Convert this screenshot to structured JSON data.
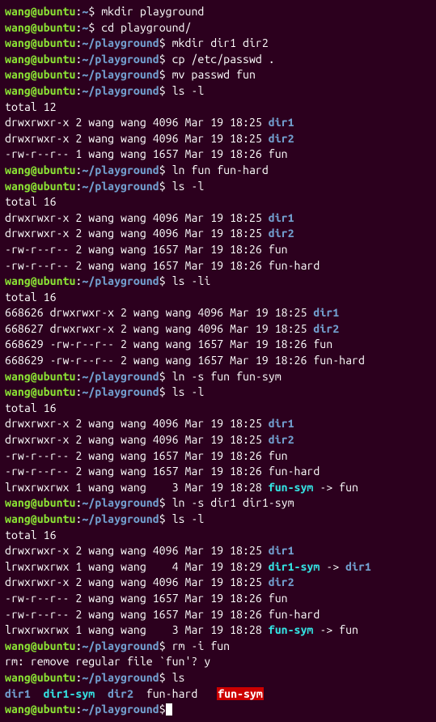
{
  "prompt": {
    "user": "wang",
    "at": "@",
    "host": "ubuntu",
    "colon": ":",
    "home": "~",
    "play": "~/playground",
    "dollar": "$"
  },
  "cmds": {
    "c1": " mkdir playground",
    "c2": " cd playground/",
    "c3": " mkdir dir1 dir2",
    "c4": " cp /etc/passwd .",
    "c5": " mv passwd fun",
    "c6": " ls -l",
    "c7": " ln fun fun-hard",
    "c8": " ls -l",
    "c9": " ls -li",
    "c10": " ln -s fun fun-sym",
    "c11": " ls -l",
    "c12": " ln -s dir1 dir1-sym",
    "c13": " ls -l",
    "c14": " rm -i fun",
    "c15": " ls",
    "c16": ""
  },
  "out": {
    "t12": "total 12",
    "t16": "total 16",
    "a1": "drwxrwxr-x 2 wang wang 4096 Mar 19 18:25 ",
    "a2": "drwxrwxr-x 2 wang wang 4096 Mar 19 18:25 ",
    "a3": "-rw-r--r-- 1 wang wang 1657 Mar 19 18:26 fun",
    "b1": "drwxrwxr-x 2 wang wang 4096 Mar 19 18:25 ",
    "b2": "drwxrwxr-x 2 wang wang 4096 Mar 19 18:25 ",
    "b3": "-rw-r--r-- 2 wang wang 1657 Mar 19 18:26 fun",
    "b4": "-rw-r--r-- 2 wang wang 1657 Mar 19 18:26 fun-hard",
    "i1": "668626 drwxrwxr-x 2 wang wang 4096 Mar 19 18:25 ",
    "i2": "668627 drwxrwxr-x 2 wang wang 4096 Mar 19 18:25 ",
    "i3": "668629 -rw-r--r-- 2 wang wang 1657 Mar 19 18:26 fun",
    "i4": "668629 -rw-r--r-- 2 wang wang 1657 Mar 19 18:26 fun-hard",
    "d1": "drwxrwxr-x 2 wang wang 4096 Mar 19 18:25 ",
    "d2": "drwxrwxr-x 2 wang wang 4096 Mar 19 18:25 ",
    "d3": "-rw-r--r-- 2 wang wang 1657 Mar 19 18:26 fun",
    "d4": "-rw-r--r-- 2 wang wang 1657 Mar 19 18:26 fun-hard",
    "d5": "lrwxrwxrwx 1 wang wang    3 Mar 19 18:28 ",
    "e1": "drwxrwxr-x 2 wang wang 4096 Mar 19 18:25 ",
    "e2": "lrwxrwxrwx 1 wang wang    4 Mar 19 18:29 ",
    "e3": "drwxrwxr-x 2 wang wang 4096 Mar 19 18:25 ",
    "e4": "-rw-r--r-- 2 wang wang 1657 Mar 19 18:26 fun",
    "e5": "-rw-r--r-- 2 wang wang 1657 Mar 19 18:26 fun-hard",
    "e6": "lrwxrwxrwx 1 wang wang    3 Mar 19 18:28 ",
    "rm": "rm: remove regular file `fun'? y"
  },
  "names": {
    "dir1": "dir1",
    "dir2": "dir2",
    "funsym": "fun-sym",
    "dir1sym": "dir1-sym",
    "arrow_fun": " -> fun",
    "arrow_dir1": " -> ",
    "sep2": "  ",
    "sep3": "   ",
    "funhard": "fun-hard"
  }
}
